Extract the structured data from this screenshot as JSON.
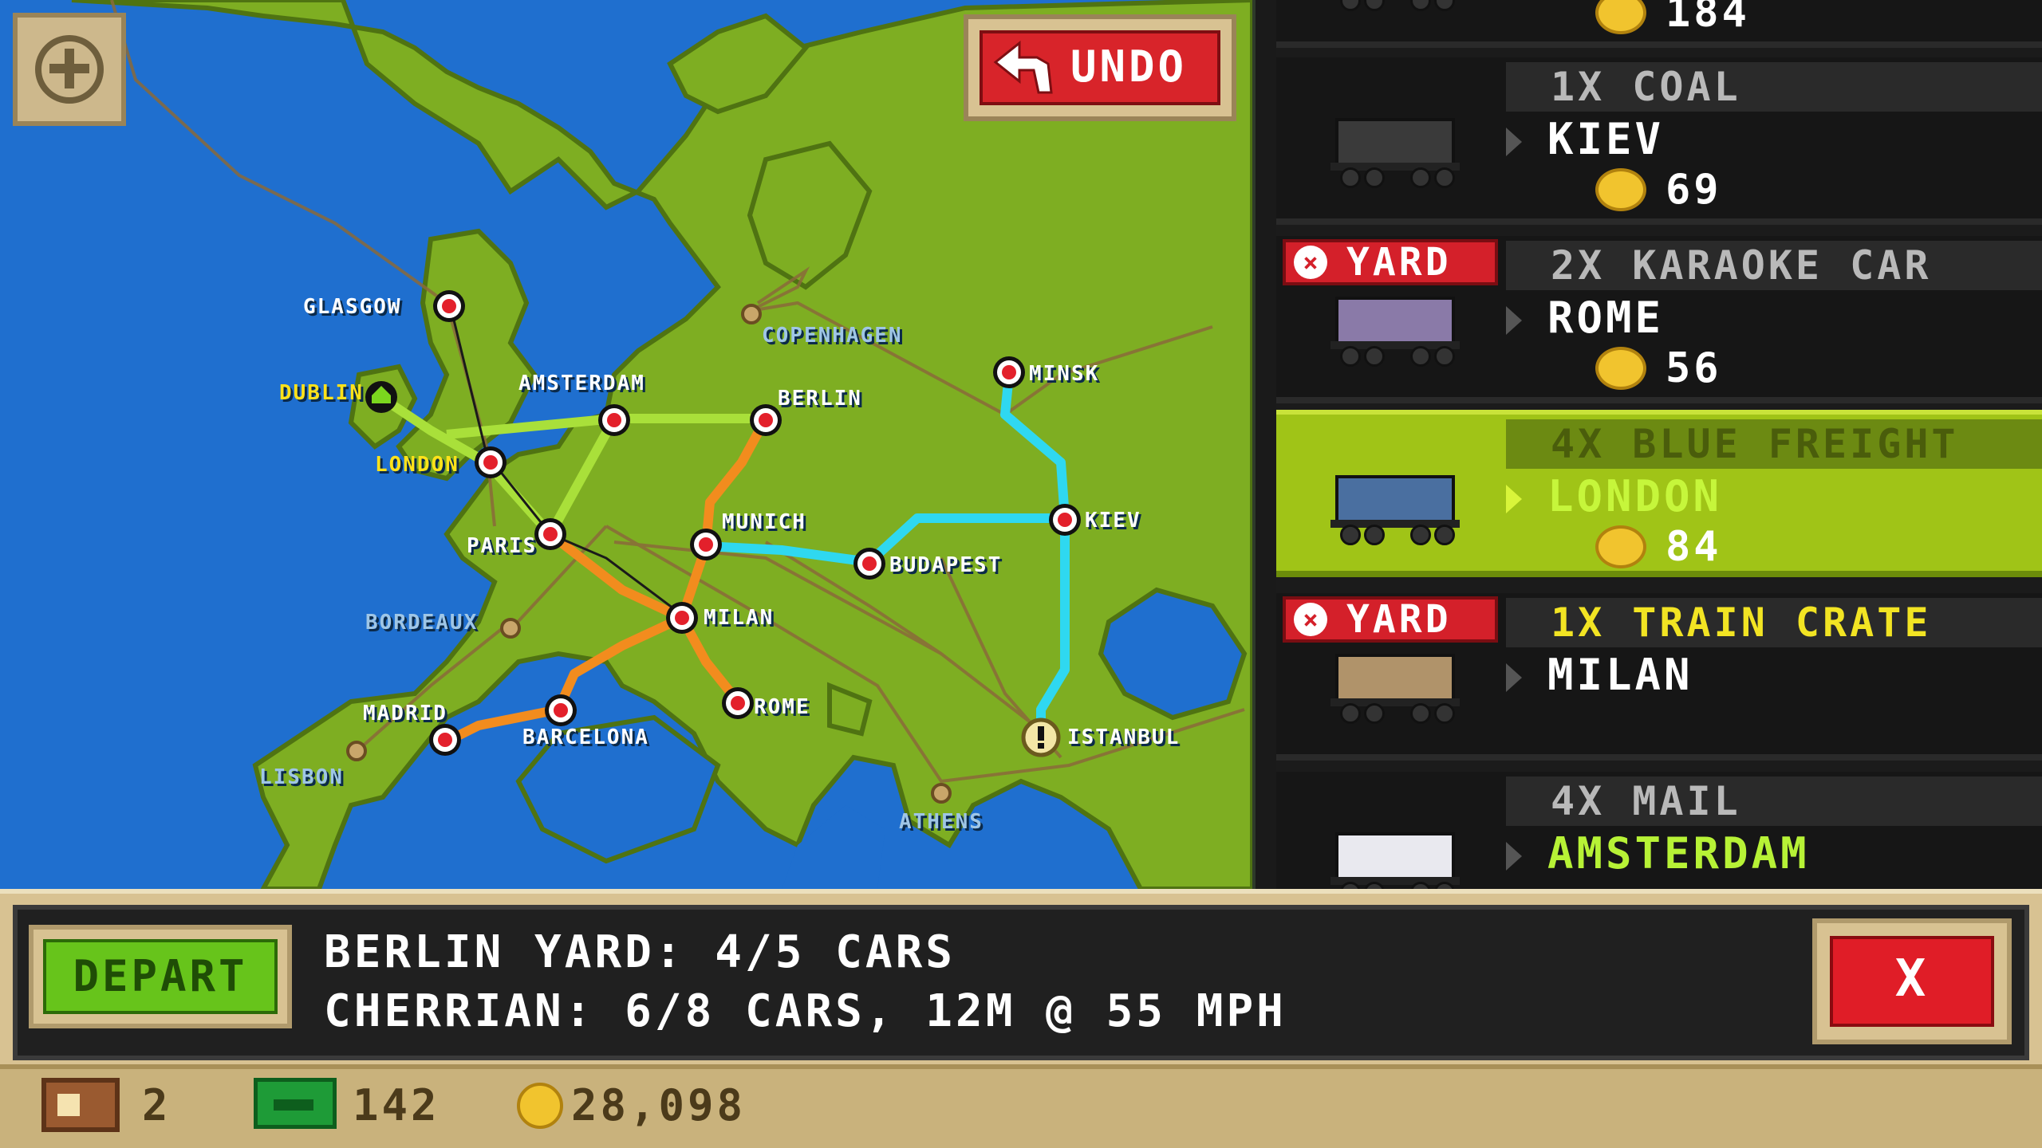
{
  "map": {
    "cities": [
      {
        "name": "GLASGOW",
        "style": "white"
      },
      {
        "name": "DUBLIN",
        "style": "yellow"
      },
      {
        "name": "LONDON",
        "style": "yellow"
      },
      {
        "name": "AMSTERDAM",
        "style": "white"
      },
      {
        "name": "BERLIN",
        "style": "white"
      },
      {
        "name": "COPENHAGEN",
        "style": "dim"
      },
      {
        "name": "MINSK",
        "style": "white"
      },
      {
        "name": "PARIS",
        "style": "white"
      },
      {
        "name": "MUNICH",
        "style": "white"
      },
      {
        "name": "KIEV",
        "style": "white"
      },
      {
        "name": "BUDAPEST",
        "style": "white"
      },
      {
        "name": "BORDEAUX",
        "style": "dim"
      },
      {
        "name": "MILAN",
        "style": "white"
      },
      {
        "name": "MADRID",
        "style": "white"
      },
      {
        "name": "BARCELONA",
        "style": "white"
      },
      {
        "name": "ROME",
        "style": "white"
      },
      {
        "name": "ISTANBUL",
        "style": "white"
      },
      {
        "name": "LISBON",
        "style": "dim"
      },
      {
        "name": "ATHENS",
        "style": "dim"
      }
    ],
    "colors": {
      "sea": "#1f6fcf",
      "land": "#7eae22",
      "line_green": "#a9e03a",
      "line_orange": "#f28c1e",
      "line_cyan": "#2fd8f0",
      "station": "#e3202b"
    }
  },
  "buttons": {
    "undo": "UNDO",
    "depart": "DEPART",
    "close": "X"
  },
  "cargo": [
    {
      "qty": "",
      "dest": "",
      "reward": "184",
      "yard": false,
      "selected": false,
      "partial": true
    },
    {
      "qty": "1X COAL",
      "dest": "KIEV",
      "reward": "69",
      "yard": false,
      "selected": false
    },
    {
      "qty": "2X KARAOKE CAR",
      "dest": "ROME",
      "reward": "56",
      "yard": true,
      "selected": false
    },
    {
      "qty": "4X BLUE FREIGHT",
      "dest": "LONDON",
      "reward": "84",
      "yard": false,
      "selected": true
    },
    {
      "qty": "1X TRAIN CRATE",
      "dest": "MILAN",
      "reward": "",
      "yard": true,
      "selected": false
    },
    {
      "qty": "4X MAIL",
      "dest": "AMSTERDAM",
      "reward": "",
      "yard": false,
      "selected": false
    }
  ],
  "yard_label": "YARD",
  "message": {
    "line1": "BERLIN YARD: 4/5 CARS",
    "line2": "CHERRIAN: 6/8 CARS, 12M @ 55 MPH"
  },
  "status": {
    "cars": "2",
    "cash": "142",
    "coins": "28,098"
  }
}
